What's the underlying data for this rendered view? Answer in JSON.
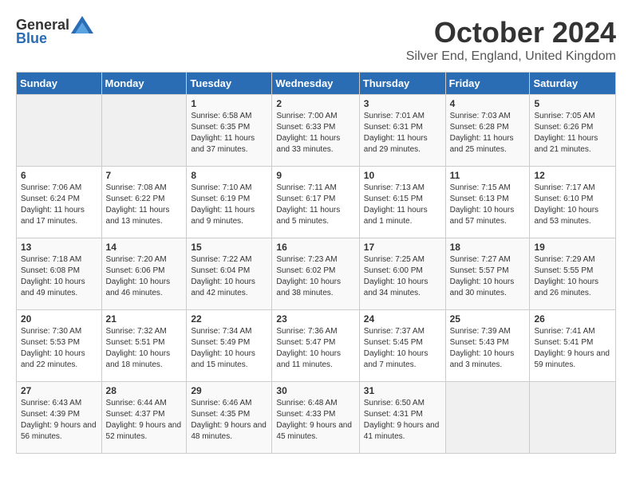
{
  "logo": {
    "general": "General",
    "blue": "Blue"
  },
  "header": {
    "title": "October 2024",
    "subtitle": "Silver End, England, United Kingdom"
  },
  "days_of_week": [
    "Sunday",
    "Monday",
    "Tuesday",
    "Wednesday",
    "Thursday",
    "Friday",
    "Saturday"
  ],
  "weeks": [
    [
      {
        "day": "",
        "sunrise": "",
        "sunset": "",
        "daylight": ""
      },
      {
        "day": "",
        "sunrise": "",
        "sunset": "",
        "daylight": ""
      },
      {
        "day": "1",
        "sunrise": "Sunrise: 6:58 AM",
        "sunset": "Sunset: 6:35 PM",
        "daylight": "Daylight: 11 hours and 37 minutes."
      },
      {
        "day": "2",
        "sunrise": "Sunrise: 7:00 AM",
        "sunset": "Sunset: 6:33 PM",
        "daylight": "Daylight: 11 hours and 33 minutes."
      },
      {
        "day": "3",
        "sunrise": "Sunrise: 7:01 AM",
        "sunset": "Sunset: 6:31 PM",
        "daylight": "Daylight: 11 hours and 29 minutes."
      },
      {
        "day": "4",
        "sunrise": "Sunrise: 7:03 AM",
        "sunset": "Sunset: 6:28 PM",
        "daylight": "Daylight: 11 hours and 25 minutes."
      },
      {
        "day": "5",
        "sunrise": "Sunrise: 7:05 AM",
        "sunset": "Sunset: 6:26 PM",
        "daylight": "Daylight: 11 hours and 21 minutes."
      }
    ],
    [
      {
        "day": "6",
        "sunrise": "Sunrise: 7:06 AM",
        "sunset": "Sunset: 6:24 PM",
        "daylight": "Daylight: 11 hours and 17 minutes."
      },
      {
        "day": "7",
        "sunrise": "Sunrise: 7:08 AM",
        "sunset": "Sunset: 6:22 PM",
        "daylight": "Daylight: 11 hours and 13 minutes."
      },
      {
        "day": "8",
        "sunrise": "Sunrise: 7:10 AM",
        "sunset": "Sunset: 6:19 PM",
        "daylight": "Daylight: 11 hours and 9 minutes."
      },
      {
        "day": "9",
        "sunrise": "Sunrise: 7:11 AM",
        "sunset": "Sunset: 6:17 PM",
        "daylight": "Daylight: 11 hours and 5 minutes."
      },
      {
        "day": "10",
        "sunrise": "Sunrise: 7:13 AM",
        "sunset": "Sunset: 6:15 PM",
        "daylight": "Daylight: 11 hours and 1 minute."
      },
      {
        "day": "11",
        "sunrise": "Sunrise: 7:15 AM",
        "sunset": "Sunset: 6:13 PM",
        "daylight": "Daylight: 10 hours and 57 minutes."
      },
      {
        "day": "12",
        "sunrise": "Sunrise: 7:17 AM",
        "sunset": "Sunset: 6:10 PM",
        "daylight": "Daylight: 10 hours and 53 minutes."
      }
    ],
    [
      {
        "day": "13",
        "sunrise": "Sunrise: 7:18 AM",
        "sunset": "Sunset: 6:08 PM",
        "daylight": "Daylight: 10 hours and 49 minutes."
      },
      {
        "day": "14",
        "sunrise": "Sunrise: 7:20 AM",
        "sunset": "Sunset: 6:06 PM",
        "daylight": "Daylight: 10 hours and 46 minutes."
      },
      {
        "day": "15",
        "sunrise": "Sunrise: 7:22 AM",
        "sunset": "Sunset: 6:04 PM",
        "daylight": "Daylight: 10 hours and 42 minutes."
      },
      {
        "day": "16",
        "sunrise": "Sunrise: 7:23 AM",
        "sunset": "Sunset: 6:02 PM",
        "daylight": "Daylight: 10 hours and 38 minutes."
      },
      {
        "day": "17",
        "sunrise": "Sunrise: 7:25 AM",
        "sunset": "Sunset: 6:00 PM",
        "daylight": "Daylight: 10 hours and 34 minutes."
      },
      {
        "day": "18",
        "sunrise": "Sunrise: 7:27 AM",
        "sunset": "Sunset: 5:57 PM",
        "daylight": "Daylight: 10 hours and 30 minutes."
      },
      {
        "day": "19",
        "sunrise": "Sunrise: 7:29 AM",
        "sunset": "Sunset: 5:55 PM",
        "daylight": "Daylight: 10 hours and 26 minutes."
      }
    ],
    [
      {
        "day": "20",
        "sunrise": "Sunrise: 7:30 AM",
        "sunset": "Sunset: 5:53 PM",
        "daylight": "Daylight: 10 hours and 22 minutes."
      },
      {
        "day": "21",
        "sunrise": "Sunrise: 7:32 AM",
        "sunset": "Sunset: 5:51 PM",
        "daylight": "Daylight: 10 hours and 18 minutes."
      },
      {
        "day": "22",
        "sunrise": "Sunrise: 7:34 AM",
        "sunset": "Sunset: 5:49 PM",
        "daylight": "Daylight: 10 hours and 15 minutes."
      },
      {
        "day": "23",
        "sunrise": "Sunrise: 7:36 AM",
        "sunset": "Sunset: 5:47 PM",
        "daylight": "Daylight: 10 hours and 11 minutes."
      },
      {
        "day": "24",
        "sunrise": "Sunrise: 7:37 AM",
        "sunset": "Sunset: 5:45 PM",
        "daylight": "Daylight: 10 hours and 7 minutes."
      },
      {
        "day": "25",
        "sunrise": "Sunrise: 7:39 AM",
        "sunset": "Sunset: 5:43 PM",
        "daylight": "Daylight: 10 hours and 3 minutes."
      },
      {
        "day": "26",
        "sunrise": "Sunrise: 7:41 AM",
        "sunset": "Sunset: 5:41 PM",
        "daylight": "Daylight: 9 hours and 59 minutes."
      }
    ],
    [
      {
        "day": "27",
        "sunrise": "Sunrise: 6:43 AM",
        "sunset": "Sunset: 4:39 PM",
        "daylight": "Daylight: 9 hours and 56 minutes."
      },
      {
        "day": "28",
        "sunrise": "Sunrise: 6:44 AM",
        "sunset": "Sunset: 4:37 PM",
        "daylight": "Daylight: 9 hours and 52 minutes."
      },
      {
        "day": "29",
        "sunrise": "Sunrise: 6:46 AM",
        "sunset": "Sunset: 4:35 PM",
        "daylight": "Daylight: 9 hours and 48 minutes."
      },
      {
        "day": "30",
        "sunrise": "Sunrise: 6:48 AM",
        "sunset": "Sunset: 4:33 PM",
        "daylight": "Daylight: 9 hours and 45 minutes."
      },
      {
        "day": "31",
        "sunrise": "Sunrise: 6:50 AM",
        "sunset": "Sunset: 4:31 PM",
        "daylight": "Daylight: 9 hours and 41 minutes."
      },
      {
        "day": "",
        "sunrise": "",
        "sunset": "",
        "daylight": ""
      },
      {
        "day": "",
        "sunrise": "",
        "sunset": "",
        "daylight": ""
      }
    ]
  ]
}
